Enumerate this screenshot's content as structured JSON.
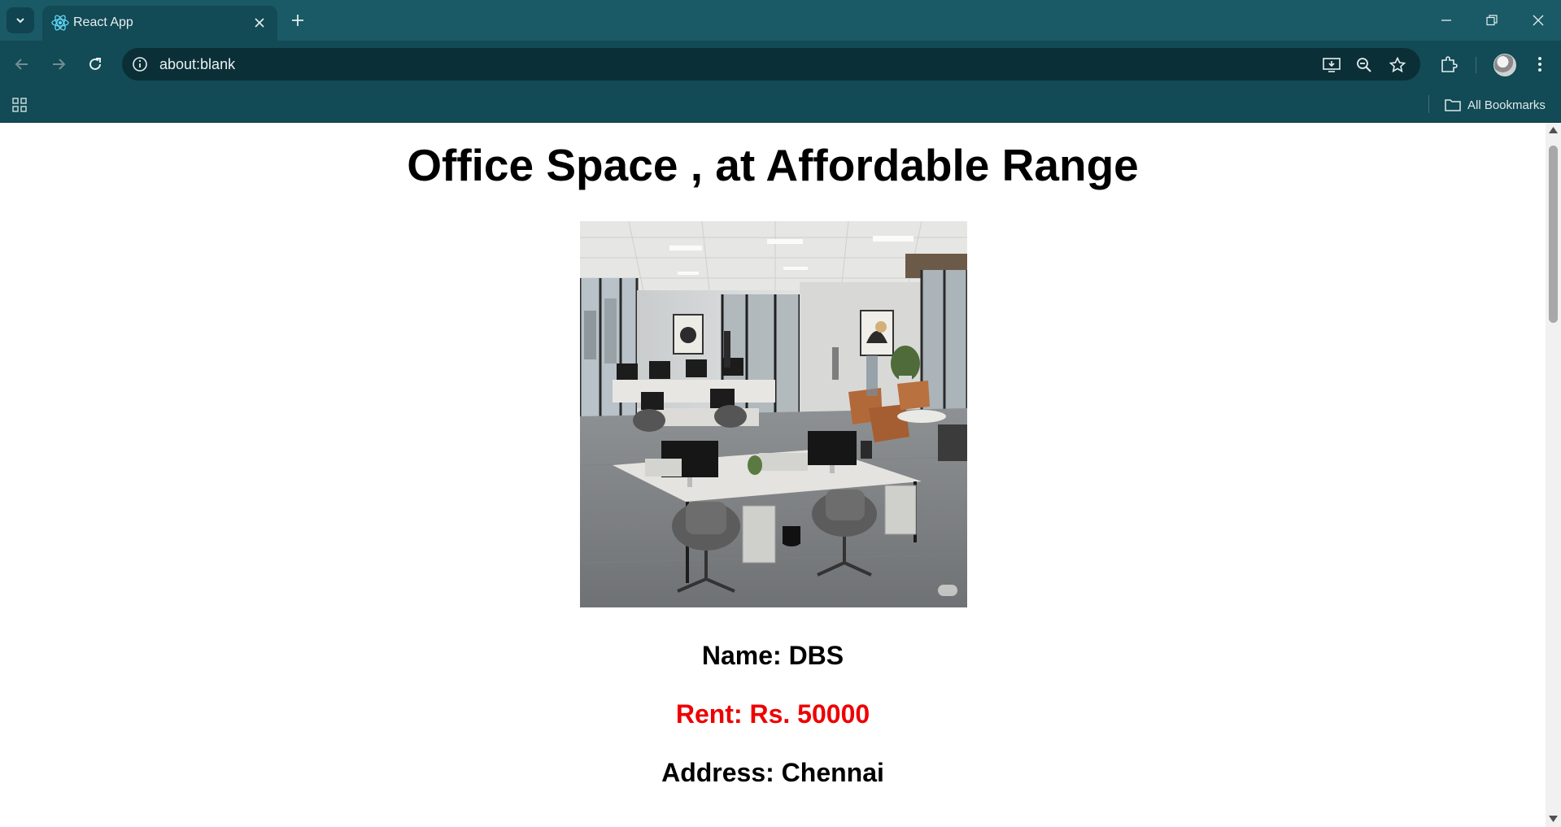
{
  "browser": {
    "tab_title": "React App",
    "url": "about:blank",
    "all_bookmarks_label": "All Bookmarks",
    "colors": {
      "tabstrip": "#1a5a66",
      "toolbar": "#124a55",
      "omnibox": "#0b2f36"
    }
  },
  "page": {
    "title": "Office Space , at Affordable Range",
    "image_alt": "Office space photo",
    "name_line": "Name: DBS",
    "rent_line": "Rent: Rs. 50000",
    "address_line": "Address: Chennai",
    "rent_color": "#ee0000"
  },
  "icons": [
    "tab-search-icon",
    "react-logo-icon",
    "close-icon",
    "plus-icon",
    "minimize-icon",
    "restore-icon",
    "back-arrow-icon",
    "forward-arrow-icon",
    "reload-icon",
    "info-icon",
    "install-app-icon",
    "zoom-out-icon",
    "star-icon",
    "extensions-icon",
    "more-vert-icon",
    "apps-grid-icon",
    "folder-icon"
  ]
}
